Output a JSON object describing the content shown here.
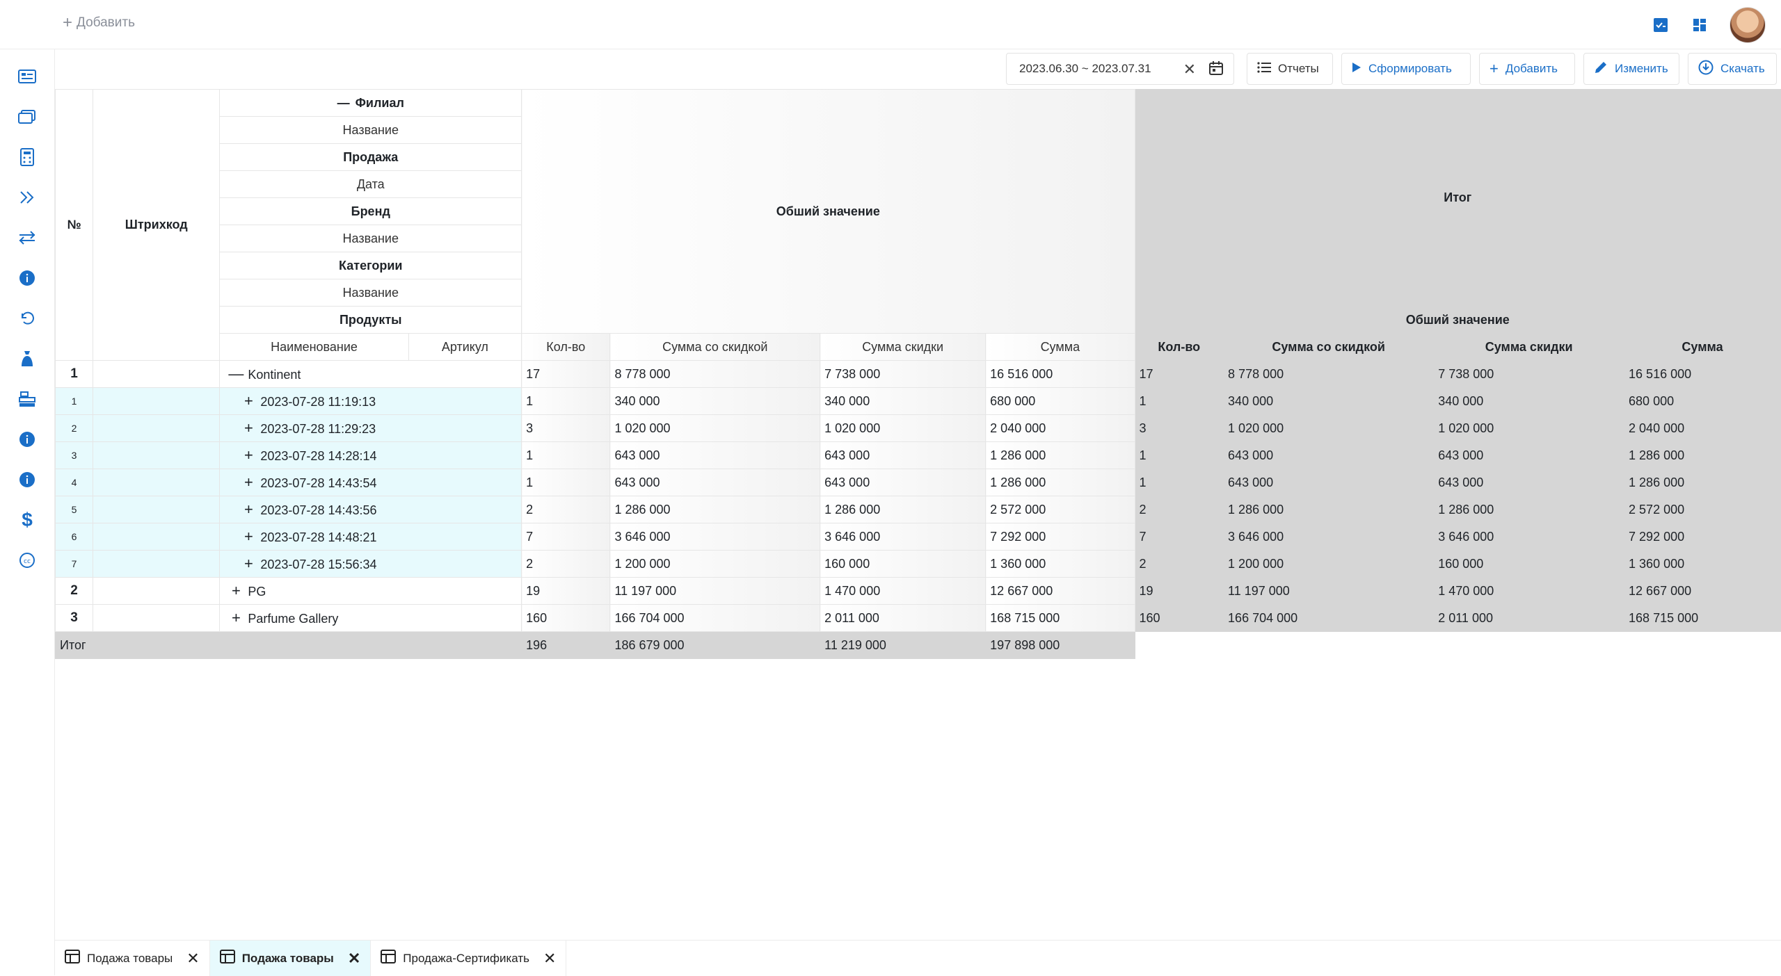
{
  "topbar": {
    "add_label": "Добавить"
  },
  "icons": {
    "top_right": [
      "report-check-icon",
      "dashboard-grid-icon"
    ],
    "sidebar": [
      "list-card-icon",
      "gallery-icon",
      "calculator-icon",
      "double-chevron-right-icon",
      "transfer-icon",
      "info-icon",
      "undo-icon",
      "money-bag-icon",
      "cash-register-icon",
      "info-icon",
      "info-icon",
      "dollar-icon",
      "copyright-icon"
    ]
  },
  "toolbar": {
    "date_range": "2023.06.30 ~ 2023.07.31",
    "reports": "Отчеты",
    "generate": "Сформировать",
    "add": "Добавить",
    "edit": "Изменить",
    "download": "Скачать"
  },
  "table": {
    "col_no": "№",
    "col_barcode": "Штрихкод",
    "groups": {
      "branch": "Филиал",
      "branch_name": "Название",
      "sale": "Продажа",
      "sale_date": "Дата",
      "brand": "Бренд",
      "brand_name": "Название",
      "category": "Категории",
      "category_name": "Название",
      "products": "Продукты"
    },
    "product_cols": {
      "name": "Наименование",
      "sku": "Артикул"
    },
    "general_value": "Обший значение",
    "total_title": "Итог",
    "total_general": "Обший значение",
    "metrics": [
      "Кол-во",
      "Сумма со скидкой",
      "Сумма скидки",
      "Сумма"
    ],
    "rows": [
      {
        "no": "1",
        "label": "Kontinent",
        "toggle": "—",
        "level": 0,
        "vals": [
          "17",
          "8 778 000",
          "7 738 000",
          "16 516 000"
        ]
      },
      {
        "no": "1",
        "label": "2023-07-28 11:19:13",
        "toggle": "+",
        "level": 1,
        "vals": [
          "1",
          "340 000",
          "340 000",
          "680 000"
        ]
      },
      {
        "no": "2",
        "label": "2023-07-28 11:29:23",
        "toggle": "+",
        "level": 1,
        "vals": [
          "3",
          "1 020 000",
          "1 020 000",
          "2 040 000"
        ]
      },
      {
        "no": "3",
        "label": "2023-07-28 14:28:14",
        "toggle": "+",
        "level": 1,
        "vals": [
          "1",
          "643 000",
          "643 000",
          "1 286 000"
        ]
      },
      {
        "no": "4",
        "label": "2023-07-28 14:43:54",
        "toggle": "+",
        "level": 1,
        "vals": [
          "1",
          "643 000",
          "643 000",
          "1 286 000"
        ]
      },
      {
        "no": "5",
        "label": "2023-07-28 14:43:56",
        "toggle": "+",
        "level": 1,
        "vals": [
          "2",
          "1 286 000",
          "1 286 000",
          "2 572 000"
        ]
      },
      {
        "no": "6",
        "label": "2023-07-28 14:48:21",
        "toggle": "+",
        "level": 1,
        "vals": [
          "7",
          "3 646 000",
          "3 646 000",
          "7 292 000"
        ]
      },
      {
        "no": "7",
        "label": "2023-07-28 15:56:34",
        "toggle": "+",
        "level": 1,
        "vals": [
          "2",
          "1 200 000",
          "160 000",
          "1 360 000"
        ]
      },
      {
        "no": "2",
        "label": "PG",
        "toggle": "+",
        "level": 0,
        "vals": [
          "19",
          "11 197 000",
          "1 470 000",
          "12 667 000"
        ]
      },
      {
        "no": "3",
        "label": "Parfume Gallery",
        "toggle": "+",
        "level": 0,
        "vals": [
          "160",
          "166 704 000",
          "2 011 000",
          "168 715 000"
        ]
      }
    ],
    "grand_total": {
      "label": "Итог",
      "vals": [
        "196",
        "186 679 000",
        "11 219 000",
        "197 898 000"
      ]
    }
  },
  "tabs": [
    {
      "label": "Подажа товары",
      "active": false
    },
    {
      "label": "Подажа товары",
      "active": true
    },
    {
      "label": "Продажа-Сертификать",
      "active": false
    }
  ]
}
